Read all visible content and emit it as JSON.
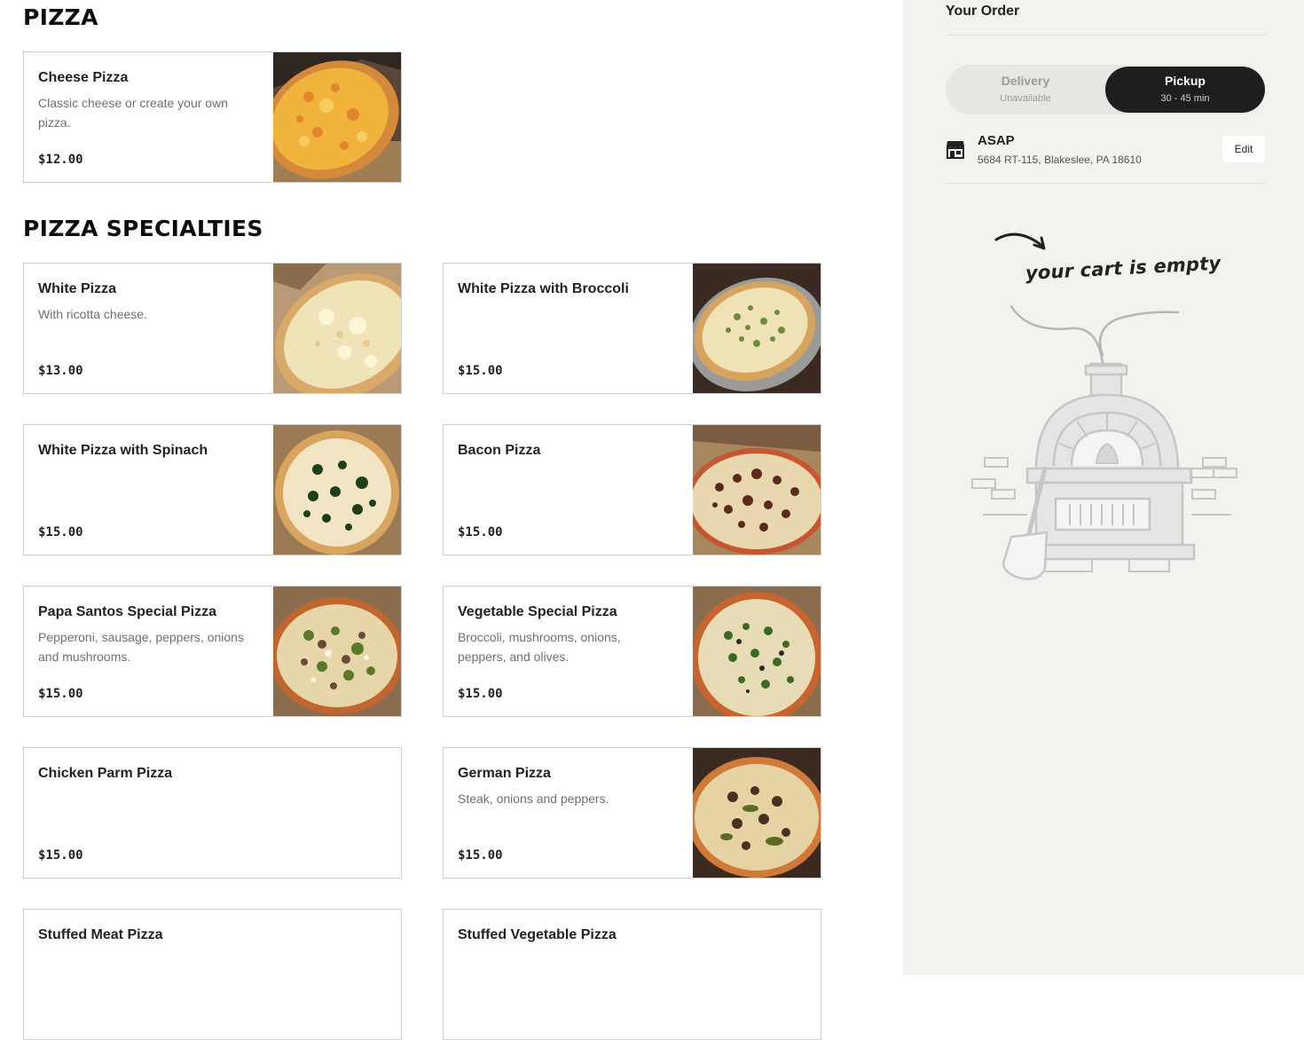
{
  "sections": {
    "pizza": "PIZZA",
    "specialties": "PIZZA SPECIALTIES"
  },
  "items": {
    "cheese": {
      "name": "Cheese Pizza",
      "desc": "Classic cheese or create your own pizza.",
      "price": "$12.00"
    },
    "white": {
      "name": "White Pizza",
      "desc": "With ricotta cheese.",
      "price": "$13.00"
    },
    "white_broccoli": {
      "name": "White Pizza with Broccoli",
      "desc": "",
      "price": "$15.00"
    },
    "white_spinach": {
      "name": "White Pizza with Spinach",
      "desc": "",
      "price": "$15.00"
    },
    "bacon": {
      "name": "Bacon Pizza",
      "desc": "",
      "price": "$15.00"
    },
    "papa_santos": {
      "name": "Papa Santos Special Pizza",
      "desc": "Pepperoni, sausage, peppers, onions and mushrooms.",
      "price": "$15.00"
    },
    "vegetable": {
      "name": "Vegetable Special Pizza",
      "desc": "Broccoli, mushrooms, onions, peppers, and olives.",
      "price": "$15.00"
    },
    "chicken_parm": {
      "name": "Chicken Parm Pizza",
      "desc": "",
      "price": "$15.00"
    },
    "german": {
      "name": "German Pizza",
      "desc": "Steak, onions and peppers.",
      "price": "$15.00"
    },
    "stuffed_meat": {
      "name": "Stuffed Meat Pizza",
      "desc": "",
      "price": ""
    },
    "stuffed_vegetable": {
      "name": "Stuffed Vegetable Pizza",
      "desc": "",
      "price": ""
    }
  },
  "order": {
    "title": "Your Order",
    "delivery_label": "Delivery",
    "delivery_sub": "Unavailable",
    "pickup_label": "Pickup",
    "pickup_sub": "30 - 45 min",
    "time_label": "ASAP",
    "address": "5684 RT-115, Blakeslee, PA 18610",
    "edit_label": "Edit",
    "empty_text": "your cart is empty"
  },
  "icons": [
    "store-icon",
    "arrow-icon",
    "pizza-oven-illustration"
  ],
  "colors": {
    "accent_dark": "#1e1e1e",
    "sidebar_bg": "#f3f2ef",
    "card_border": "#cfcfcf"
  }
}
